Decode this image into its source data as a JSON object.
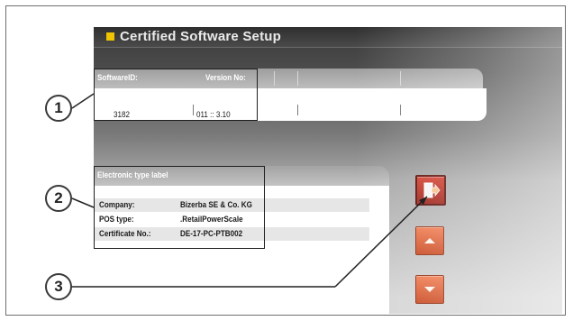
{
  "window": {
    "title": "Certified Software Setup"
  },
  "software_panel": {
    "headers": [
      "SoftwareID:",
      "Version No:"
    ],
    "values": [
      "3182",
      "011 :: 3.10"
    ]
  },
  "type_label_panel": {
    "header": "Electronic type label",
    "rows": [
      {
        "key": "Company:",
        "value": "Bizerba SE & Co. KG"
      },
      {
        "key": "POS type:",
        "value": ".RetailPowerScale"
      },
      {
        "key": "Certificate No.:",
        "value": "DE-17-PC-PTB002"
      }
    ]
  },
  "buttons": {
    "exit": {
      "icon": "exit-icon",
      "color": "#c43226"
    },
    "up": {
      "icon": "arrow-up-icon",
      "color": "#e0602f"
    },
    "down": {
      "icon": "arrow-down-icon",
      "color": "#e0602f"
    }
  },
  "callouts": [
    "1",
    "2",
    "3"
  ],
  "colors": {
    "title_accent": "#f0c400",
    "button_orange": "#e0602f"
  }
}
